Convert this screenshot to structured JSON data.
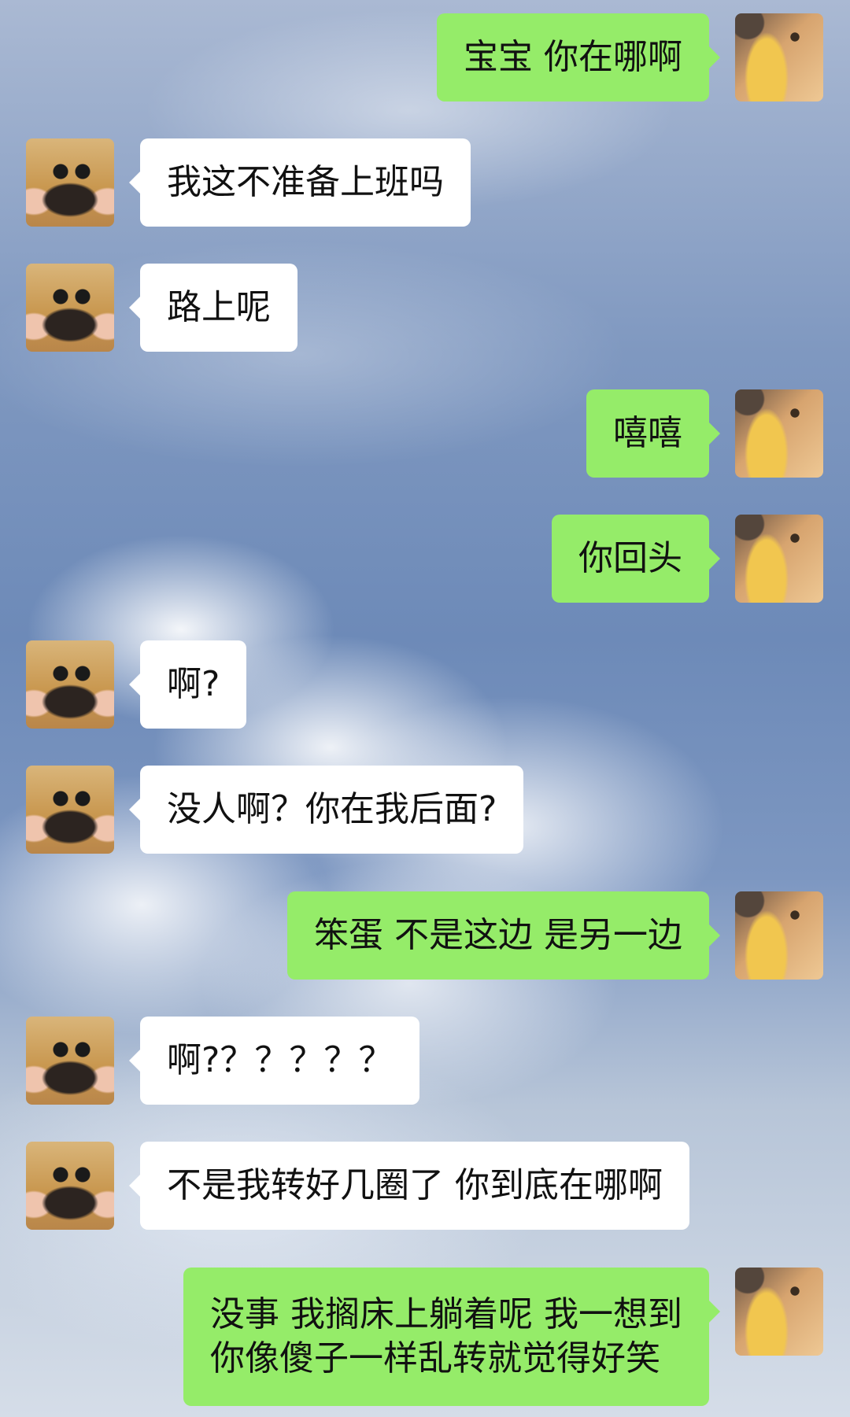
{
  "chat": {
    "messages": [
      {
        "sender": "me",
        "avatar": "cat-avatar",
        "text": "宝宝 你在哪啊"
      },
      {
        "sender": "other",
        "avatar": "dog-avatar",
        "text": "我这不准备上班吗"
      },
      {
        "sender": "other",
        "avatar": "dog-avatar",
        "text": "路上呢"
      },
      {
        "sender": "me",
        "avatar": "cat-avatar",
        "text": "嘻嘻"
      },
      {
        "sender": "me",
        "avatar": "cat-avatar",
        "text": "你回头"
      },
      {
        "sender": "other",
        "avatar": "dog-avatar",
        "text": "啊?"
      },
      {
        "sender": "other",
        "avatar": "dog-avatar",
        "text": "没人啊？你在我后面?"
      },
      {
        "sender": "me",
        "avatar": "cat-avatar",
        "text": "笨蛋 不是这边 是另一边"
      },
      {
        "sender": "other",
        "avatar": "dog-avatar",
        "text": "啊?？？？？？"
      },
      {
        "sender": "other",
        "avatar": "dog-avatar",
        "text": "不是我转好几圈了 你到底在哪啊"
      },
      {
        "sender": "me",
        "avatar": "cat-avatar",
        "text": "没事 我搁床上躺着呢 我一想到\n你像傻子一样乱转就觉得好笑"
      }
    ]
  },
  "colors": {
    "outgoing_bubble": "#95ec69",
    "incoming_bubble": "#ffffff",
    "text": "#111111"
  }
}
